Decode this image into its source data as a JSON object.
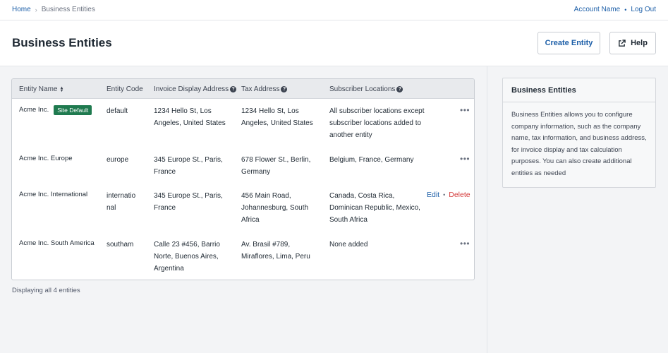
{
  "breadcrumb": {
    "home": "Home",
    "current": "Business Entities"
  },
  "account": {
    "name": "Account Name",
    "logout": "Log Out"
  },
  "header": {
    "title": "Business Entities",
    "create_label": "Create Entity",
    "help_label": "Help"
  },
  "table": {
    "columns": [
      "Entity Name",
      "Entity Code",
      "Invoice Display Address",
      "Tax Address",
      "Subscriber Locations"
    ],
    "rows": [
      {
        "name": "Acme Inc.",
        "badge": "Site Default",
        "code": "default",
        "invoice": [
          "1234 Hello St, Los",
          "Angeles, United States"
        ],
        "tax": [
          "1234 Hello St, Los",
          "Angeles, United States"
        ],
        "locations": [
          "All subscriber locations except",
          "subscriber locations added to",
          "another entity"
        ],
        "action": "more"
      },
      {
        "name": "Acme Inc. Europe",
        "code": "europe",
        "invoice": [
          "345 Europe St., Paris,",
          "France"
        ],
        "tax": [
          "678 Flower St., Berlin,",
          "Germany"
        ],
        "locations": [
          "Belgium, France, Germany"
        ],
        "action": "more"
      },
      {
        "name": "Acme Inc. International",
        "code": [
          "internatio",
          "nal"
        ],
        "invoice": [
          "345 Europe St., Paris,",
          "France"
        ],
        "tax": [
          "456 Main Road,",
          "Johannesburg, South",
          "Africa"
        ],
        "locations": [
          "Canada, Costa Rica,",
          "Dominican Republic, Mexico,",
          "South Africa"
        ],
        "action": "edit-delete",
        "edit_label": "Edit",
        "delete_label": "Delete"
      },
      {
        "name": "Acme Inc. South America",
        "code": "southam",
        "invoice": [
          "Calle 23 #456, Barrio",
          "Norte, Buenos Aires,",
          "Argentina"
        ],
        "tax": [
          "Av. Brasil #789,",
          "Miraflores, Lima, Peru"
        ],
        "locations": [
          "None added"
        ],
        "action": "more"
      }
    ],
    "footer": "Displaying all 4 entities"
  },
  "sidebar": {
    "title": "Business Entities",
    "body": [
      "Business Entities allows you to configure",
      "company information, such as the company",
      "name, tax information, and business address,",
      "for invoice display and tax calculation",
      "purposes. You can also create additional",
      "entities as needed"
    ]
  },
  "colors": {
    "accent": "#1d5fa8",
    "badge": "#1f7a4f",
    "danger": "#d43b3b"
  }
}
